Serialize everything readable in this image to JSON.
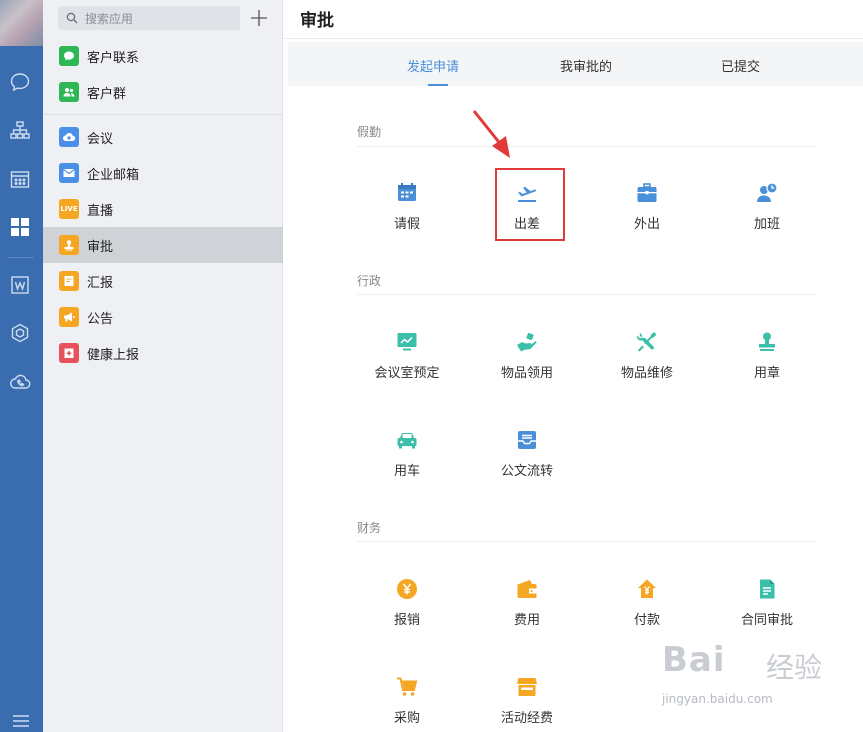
{
  "sidebar": {
    "search_placeholder": "搜索应用",
    "apps": [
      {
        "label": "客户联系",
        "color": "#2eb855",
        "icon": "chat-icon"
      },
      {
        "label": "客户群",
        "color": "#2eb855",
        "icon": "group-icon"
      },
      {
        "label": "会议",
        "color": "#4a8fe8",
        "icon": "cloud-icon"
      },
      {
        "label": "企业邮箱",
        "color": "#4a8fe8",
        "icon": "mail-icon"
      },
      {
        "label": "直播",
        "color": "#f5a623",
        "icon": "live-icon",
        "badge": "LIVE"
      },
      {
        "label": "审批",
        "color": "#f5a623",
        "icon": "stamp-icon"
      },
      {
        "label": "汇报",
        "color": "#f5a623",
        "icon": "report-icon"
      },
      {
        "label": "公告",
        "color": "#f5a623",
        "icon": "megaphone-icon"
      },
      {
        "label": "健康上报",
        "color": "#e8505b",
        "icon": "medical-icon"
      }
    ]
  },
  "main": {
    "title": "审批",
    "tabs": [
      "发起申请",
      "我审批的",
      "已提交"
    ],
    "sections": [
      {
        "title": "假勤",
        "items": [
          {
            "label": "请假",
            "icon": "calendar-icon",
            "color": "#4a90d9"
          },
          {
            "label": "出差",
            "icon": "airplane-icon",
            "color": "#4a90d9"
          },
          {
            "label": "外出",
            "icon": "briefcase-icon",
            "color": "#4a90d9"
          },
          {
            "label": "加班",
            "icon": "overtime-icon",
            "color": "#4a90d9"
          }
        ]
      },
      {
        "title": "行政",
        "items": [
          {
            "label": "会议室预定",
            "icon": "meeting-room-icon",
            "color": "#3cbfa8"
          },
          {
            "label": "物品领用",
            "icon": "hand-item-icon",
            "color": "#3cbfa8"
          },
          {
            "label": "物品维修",
            "icon": "tools-icon",
            "color": "#3cbfa8"
          },
          {
            "label": "用章",
            "icon": "seal-icon",
            "color": "#3cbfa8"
          },
          {
            "label": "用车",
            "icon": "car-icon",
            "color": "#3cbfa8"
          },
          {
            "label": "公文流转",
            "icon": "inbox-icon",
            "color": "#4a90d9"
          }
        ]
      },
      {
        "title": "财务",
        "items": [
          {
            "label": "报销",
            "icon": "yen-coin-icon",
            "color": "#f5a623"
          },
          {
            "label": "费用",
            "icon": "wallet-icon",
            "color": "#f5a623"
          },
          {
            "label": "付款",
            "icon": "yen-house-icon",
            "color": "#f5a623"
          },
          {
            "label": "合同审批",
            "icon": "document-icon",
            "color": "#3cbfa8"
          },
          {
            "label": "采购",
            "icon": "cart-icon",
            "color": "#f5a623"
          },
          {
            "label": "活动经费",
            "icon": "shop-icon",
            "color": "#f5a623"
          }
        ]
      }
    ]
  },
  "watermark": {
    "logo": "Bai",
    "cn": "经验",
    "url": "jingyan.baidu.com"
  }
}
